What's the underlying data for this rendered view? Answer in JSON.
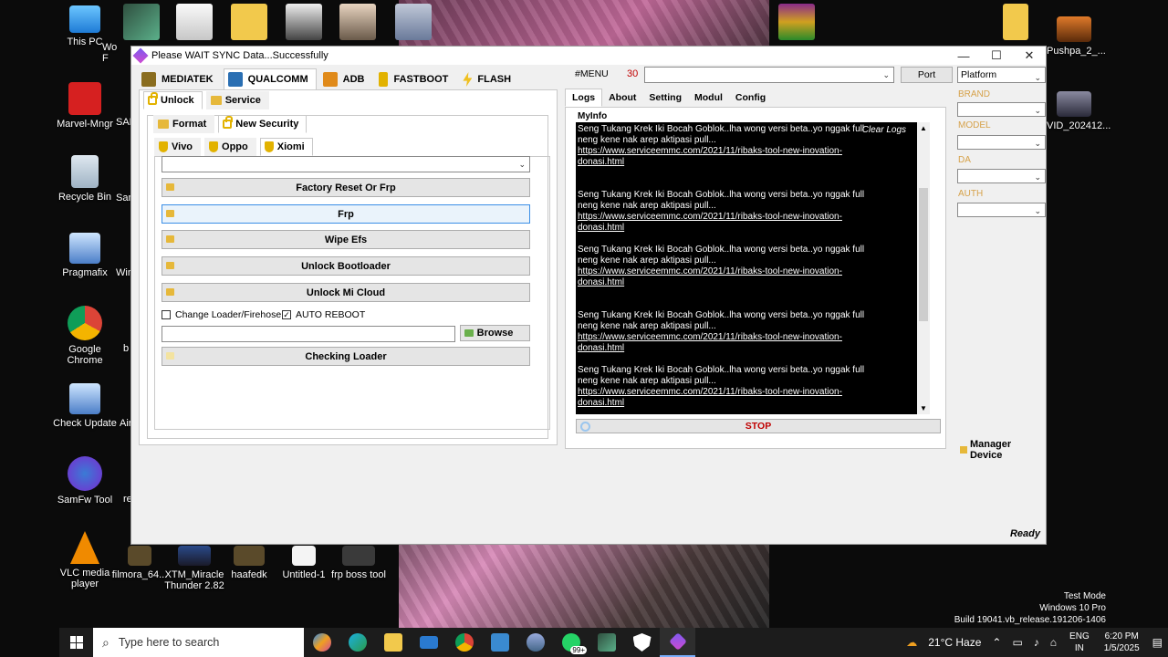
{
  "desktop": {
    "icons_left": [
      {
        "label": "This PC"
      },
      {
        "label": "Marvel-Mngr"
      },
      {
        "label": "Recycle Bin"
      },
      {
        "label": "Pragmafix"
      },
      {
        "label": "Google Chrome"
      },
      {
        "label": "Check Update"
      },
      {
        "label": "SamFw Tool"
      },
      {
        "label": "VLC media player"
      }
    ],
    "icons_col2_partial": [
      "Wo",
      "F",
      "SAM",
      "Sam",
      "Win",
      "b",
      "Air",
      "re"
    ],
    "icons_bottom": [
      {
        "label": "filmora_64..."
      },
      {
        "label": "XTM_Miracle Thunder 2.82"
      },
      {
        "label": "haafedk"
      },
      {
        "label": "Untitled-1"
      },
      {
        "label": "frp boss tool"
      }
    ],
    "icons_right": [
      {
        "label": "Pushpa_2_..."
      },
      {
        "label": "VID_202412..."
      }
    ]
  },
  "window": {
    "title": "Please WAIT SYNC Data...Successfully",
    "controls": {
      "minimize": "—",
      "maximize": "☐",
      "close": "✕"
    }
  },
  "main_tabs": [
    {
      "label": "MEDIATEK",
      "color": "#8a6d1f"
    },
    {
      "label": "QUALCOMM",
      "color": "#2a6fb3"
    },
    {
      "label": "ADB",
      "color": "#e08a1a"
    },
    {
      "label": "FASTBOOT",
      "color": "#e2b200"
    },
    {
      "label": "FLASH",
      "color": "#f0c020"
    }
  ],
  "sub_tabs_1": [
    "Unlock",
    "Service"
  ],
  "sub_tabs_2": [
    "Format",
    "New Security"
  ],
  "sub_tabs_3": [
    "Vivo",
    "Oppo",
    "Xiomi"
  ],
  "device_select": {
    "value": ""
  },
  "actions": [
    {
      "label": "Factory Reset Or Frp"
    },
    {
      "label": "Frp"
    },
    {
      "label": "Wipe Efs"
    },
    {
      "label": "Unlock Bootloader"
    },
    {
      "label": "Unlock Mi Cloud"
    }
  ],
  "options": {
    "change_loader": {
      "label": "Change Loader/Firehose",
      "checked": false
    },
    "auto_reboot": {
      "label": "AUTO REBOOT",
      "checked": true
    }
  },
  "loader_path": {
    "value": ""
  },
  "browse_label": "Browse",
  "checking_loader_label": "Checking Loader",
  "menu": {
    "label": "#MENU",
    "count": "30",
    "value": ""
  },
  "port_label": "Port",
  "platform": {
    "value": "Platform"
  },
  "right_tabs": [
    "Logs",
    "About",
    "Setting",
    "Modul",
    "Config"
  ],
  "myinfo_label": "MyInfo",
  "clear_logs_label": "Clear Logs",
  "logs": [
    {
      "line1": "Seng Tukang Krek Iki Bocah Goblok..lha wong versi beta..yo nggak full",
      "line2": "neng kene nak arep aktipasi pull...",
      "link": "https://www.serviceemmc.com/2021/11/ribaks-tool-new-inovation-donasi.html"
    },
    {
      "line1": "Seng Tukang Krek Iki Bocah Goblok..lha wong versi beta..yo nggak full",
      "line2": "neng kene nak arep aktipasi pull...",
      "link": "https://www.serviceemmc.com/2021/11/ribaks-tool-new-inovation-donasi.html"
    },
    {
      "line1": "Seng Tukang Krek Iki Bocah Goblok..lha wong versi beta..yo nggak full",
      "line2": "neng kene nak arep aktipasi pull...",
      "link": "https://www.serviceemmc.com/2021/11/ribaks-tool-new-inovation-donasi.html"
    },
    {
      "line1": "Seng Tukang Krek Iki Bocah Goblok..lha wong versi beta..yo nggak full",
      "line2": "neng kene nak arep aktipasi pull...",
      "link": "https://www.serviceemmc.com/2021/11/ribaks-tool-new-inovation-donasi.html"
    },
    {
      "line1": "Seng Tukang Krek Iki Bocah Goblok..lha wong versi beta..yo nggak full",
      "line2": "neng kene nak arep aktipasi pull...",
      "link": "https://www.serviceemmc.com/2021/11/ribaks-tool-new-inovation-donasi.html"
    }
  ],
  "stop_label": "STOP",
  "side_fields": [
    {
      "label": "BRAND",
      "value": ""
    },
    {
      "label": "MODEL",
      "value": ""
    },
    {
      "label": "DA",
      "value": ""
    },
    {
      "label": "AUTH",
      "value": ""
    }
  ],
  "manager_label": "Manager Device",
  "status": "Ready",
  "watermark": {
    "line1": "Test Mode",
    "line2": "Windows 10 Pro",
    "line3": "Build 19041.vb_release.191206-1406"
  },
  "taskbar": {
    "search_placeholder": "Type here to search",
    "badge": "99+",
    "weather": "21°C  Haze",
    "lang1": "ENG",
    "lang2": "IN",
    "time": "6:20 PM",
    "date": "1/5/2025"
  }
}
